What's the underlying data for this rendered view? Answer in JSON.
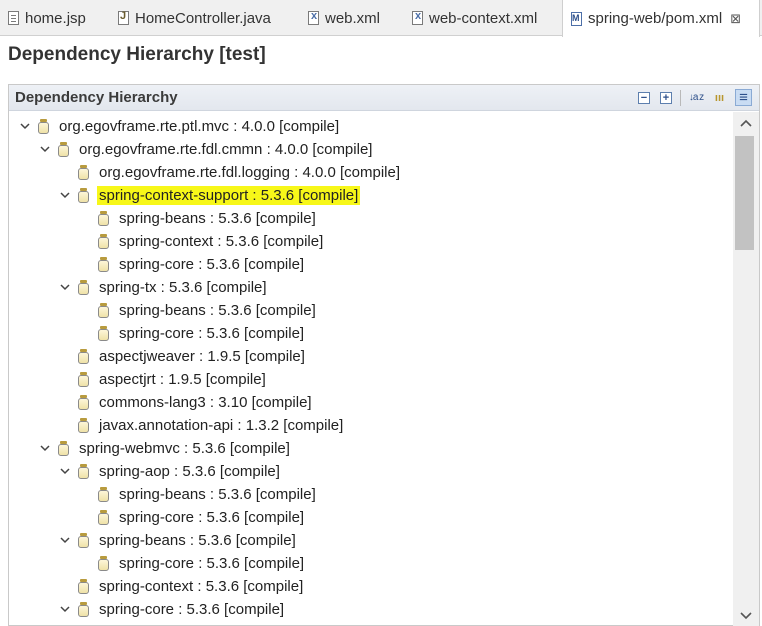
{
  "tabs": [
    {
      "label": "home.jsp",
      "icon": "file-icon"
    },
    {
      "label": "HomeController.java",
      "icon": "java-file-icon"
    },
    {
      "label": "web.xml",
      "icon": "xml-file-icon"
    },
    {
      "label": "web-context.xml",
      "icon": "xml-file-icon"
    },
    {
      "label": "spring-web/pom.xml",
      "icon": "pom-file-icon",
      "close": "⊠"
    }
  ],
  "editor": {
    "title": "Dependency Hierarchy [test]"
  },
  "section": {
    "title": "Dependency Hierarchy"
  },
  "toolbar": {
    "collapse": "−",
    "expand": "+",
    "sort": "↓a z",
    "group": "ııı",
    "filter": "≡"
  },
  "highlight_color": "#f7f719",
  "tree": [
    {
      "label": "org.egovframe.rte.ptl.mvc : 4.0.0 [compile]",
      "level": 0,
      "state": "expanded"
    },
    {
      "label": "org.egovframe.rte.fdl.cmmn : 4.0.0 [compile]",
      "level": 1,
      "state": "expanded"
    },
    {
      "label": "org.egovframe.rte.fdl.logging : 4.0.0 [compile]",
      "level": 2,
      "state": "leaf"
    },
    {
      "label": "spring-context-support : 5.3.6 [compile]",
      "level": 2,
      "state": "expanded",
      "highlighted": true
    },
    {
      "label": "spring-beans : 5.3.6 [compile]",
      "level": 3,
      "state": "leaf"
    },
    {
      "label": "spring-context : 5.3.6 [compile]",
      "level": 3,
      "state": "leaf"
    },
    {
      "label": "spring-core : 5.3.6 [compile]",
      "level": 3,
      "state": "leaf"
    },
    {
      "label": "spring-tx : 5.3.6 [compile]",
      "level": 2,
      "state": "expanded"
    },
    {
      "label": "spring-beans : 5.3.6 [compile]",
      "level": 3,
      "state": "leaf"
    },
    {
      "label": "spring-core : 5.3.6 [compile]",
      "level": 3,
      "state": "leaf"
    },
    {
      "label": "aspectjweaver : 1.9.5 [compile]",
      "level": 2,
      "state": "leaf"
    },
    {
      "label": "aspectjrt : 1.9.5 [compile]",
      "level": 2,
      "state": "leaf"
    },
    {
      "label": "commons-lang3 : 3.10 [compile]",
      "level": 2,
      "state": "leaf"
    },
    {
      "label": "javax.annotation-api : 1.3.2 [compile]",
      "level": 2,
      "state": "leaf"
    },
    {
      "label": "spring-webmvc : 5.3.6 [compile]",
      "level": 1,
      "state": "expanded"
    },
    {
      "label": "spring-aop : 5.3.6 [compile]",
      "level": 2,
      "state": "expanded"
    },
    {
      "label": "spring-beans : 5.3.6 [compile]",
      "level": 3,
      "state": "leaf"
    },
    {
      "label": "spring-core : 5.3.6 [compile]",
      "level": 3,
      "state": "leaf"
    },
    {
      "label": "spring-beans : 5.3.6 [compile]",
      "level": 2,
      "state": "expanded"
    },
    {
      "label": "spring-core : 5.3.6 [compile]",
      "level": 3,
      "state": "leaf"
    },
    {
      "label": "spring-context : 5.3.6 [compile]",
      "level": 2,
      "state": "leaf"
    },
    {
      "label": "spring-core : 5.3.6 [compile]",
      "level": 2,
      "state": "expanded"
    }
  ]
}
